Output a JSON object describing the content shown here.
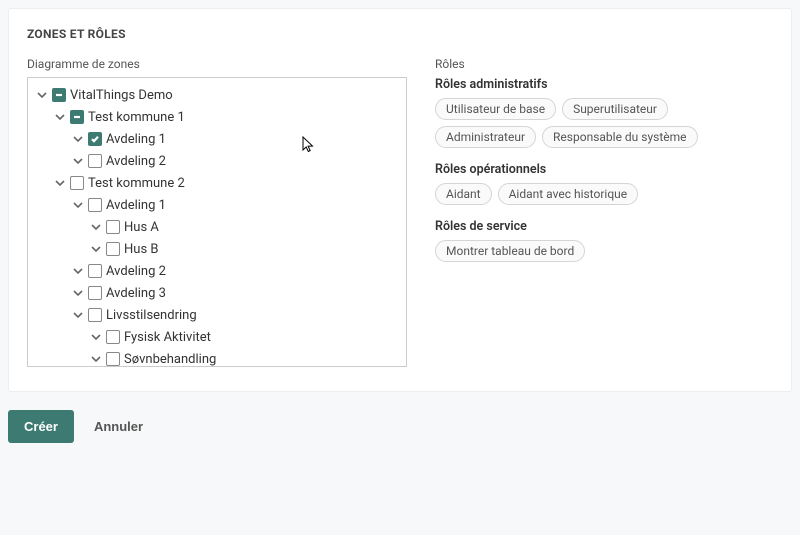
{
  "panel": {
    "title": "ZONES ET RÔLES",
    "zones_label": "Diagramme de zones",
    "roles_label": "Rôles"
  },
  "tree": [
    {
      "id": "vitalthings",
      "label": "VitalThings Demo",
      "depth": 0,
      "state": "indeterminate",
      "expanded": true
    },
    {
      "id": "kommune1",
      "label": "Test kommune 1",
      "depth": 1,
      "state": "indeterminate",
      "expanded": true
    },
    {
      "id": "k1-avd1",
      "label": "Avdeling 1",
      "depth": 2,
      "state": "checked",
      "expanded": true
    },
    {
      "id": "k1-avd2",
      "label": "Avdeling 2",
      "depth": 2,
      "state": "unchecked",
      "expanded": true
    },
    {
      "id": "kommune2",
      "label": "Test kommune 2",
      "depth": 1,
      "state": "unchecked",
      "expanded": true
    },
    {
      "id": "k2-avd1",
      "label": "Avdeling 1",
      "depth": 2,
      "state": "unchecked",
      "expanded": true
    },
    {
      "id": "k2-husA",
      "label": "Hus A",
      "depth": 3,
      "state": "unchecked",
      "expanded": true
    },
    {
      "id": "k2-husB",
      "label": "Hus B",
      "depth": 3,
      "state": "unchecked",
      "expanded": true
    },
    {
      "id": "k2-avd2",
      "label": "Avdeling 2",
      "depth": 2,
      "state": "unchecked",
      "expanded": true
    },
    {
      "id": "k2-avd3",
      "label": "Avdeling 3",
      "depth": 2,
      "state": "unchecked",
      "expanded": true
    },
    {
      "id": "livsstil",
      "label": "Livsstilsendring",
      "depth": 2,
      "state": "unchecked",
      "expanded": true
    },
    {
      "id": "fysisk",
      "label": "Fysisk Aktivitet",
      "depth": 3,
      "state": "unchecked",
      "expanded": true
    },
    {
      "id": "sovn",
      "label": "Søvnbehandling",
      "depth": 3,
      "state": "unchecked",
      "expanded": true
    }
  ],
  "roles": {
    "admin": {
      "title": "Rôles administratifs",
      "items": [
        "Utilisateur de base",
        "Superutilisateur",
        "Administrateur",
        "Responsable du système"
      ]
    },
    "operational": {
      "title": "Rôles opérationnels",
      "items": [
        "Aidant",
        "Aidant avec historique"
      ]
    },
    "service": {
      "title": "Rôles de service",
      "items": [
        "Montrer tableau de bord"
      ]
    }
  },
  "footer": {
    "create": "Créer",
    "cancel": "Annuler"
  }
}
